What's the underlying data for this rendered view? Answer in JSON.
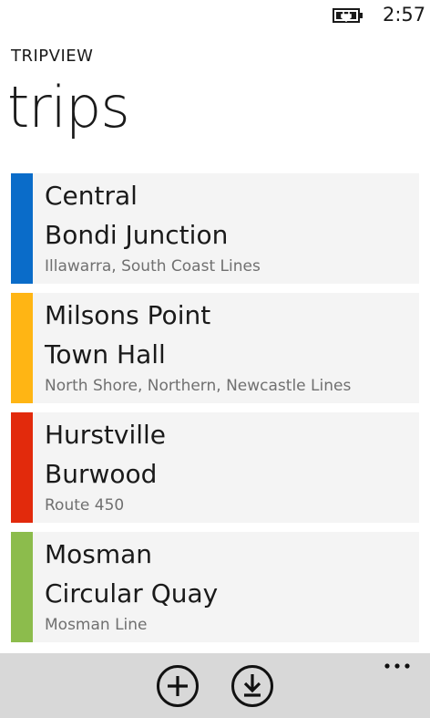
{
  "status": {
    "time": "2:57"
  },
  "app": {
    "name": "TRIPVIEW",
    "title": "trips"
  },
  "trips": [
    {
      "origin": "Central",
      "destination": "Bondi Junction",
      "line": "Illawarra, South Coast Lines",
      "color": "#0a6cc9"
    },
    {
      "origin": "Milsons Point",
      "destination": "Town Hall",
      "line": "North Shore, Northern, Newcastle Lines",
      "color": "#ffb514"
    },
    {
      "origin": "Hurstville",
      "destination": "Burwood",
      "line": "Route 450",
      "color": "#e22a0c"
    },
    {
      "origin": "Mosman",
      "destination": "Circular Quay",
      "line": "Mosman Line",
      "color": "#8cbc4c"
    }
  ],
  "appbar": {
    "icons": [
      "add-icon",
      "download-icon",
      "more-icon"
    ]
  }
}
